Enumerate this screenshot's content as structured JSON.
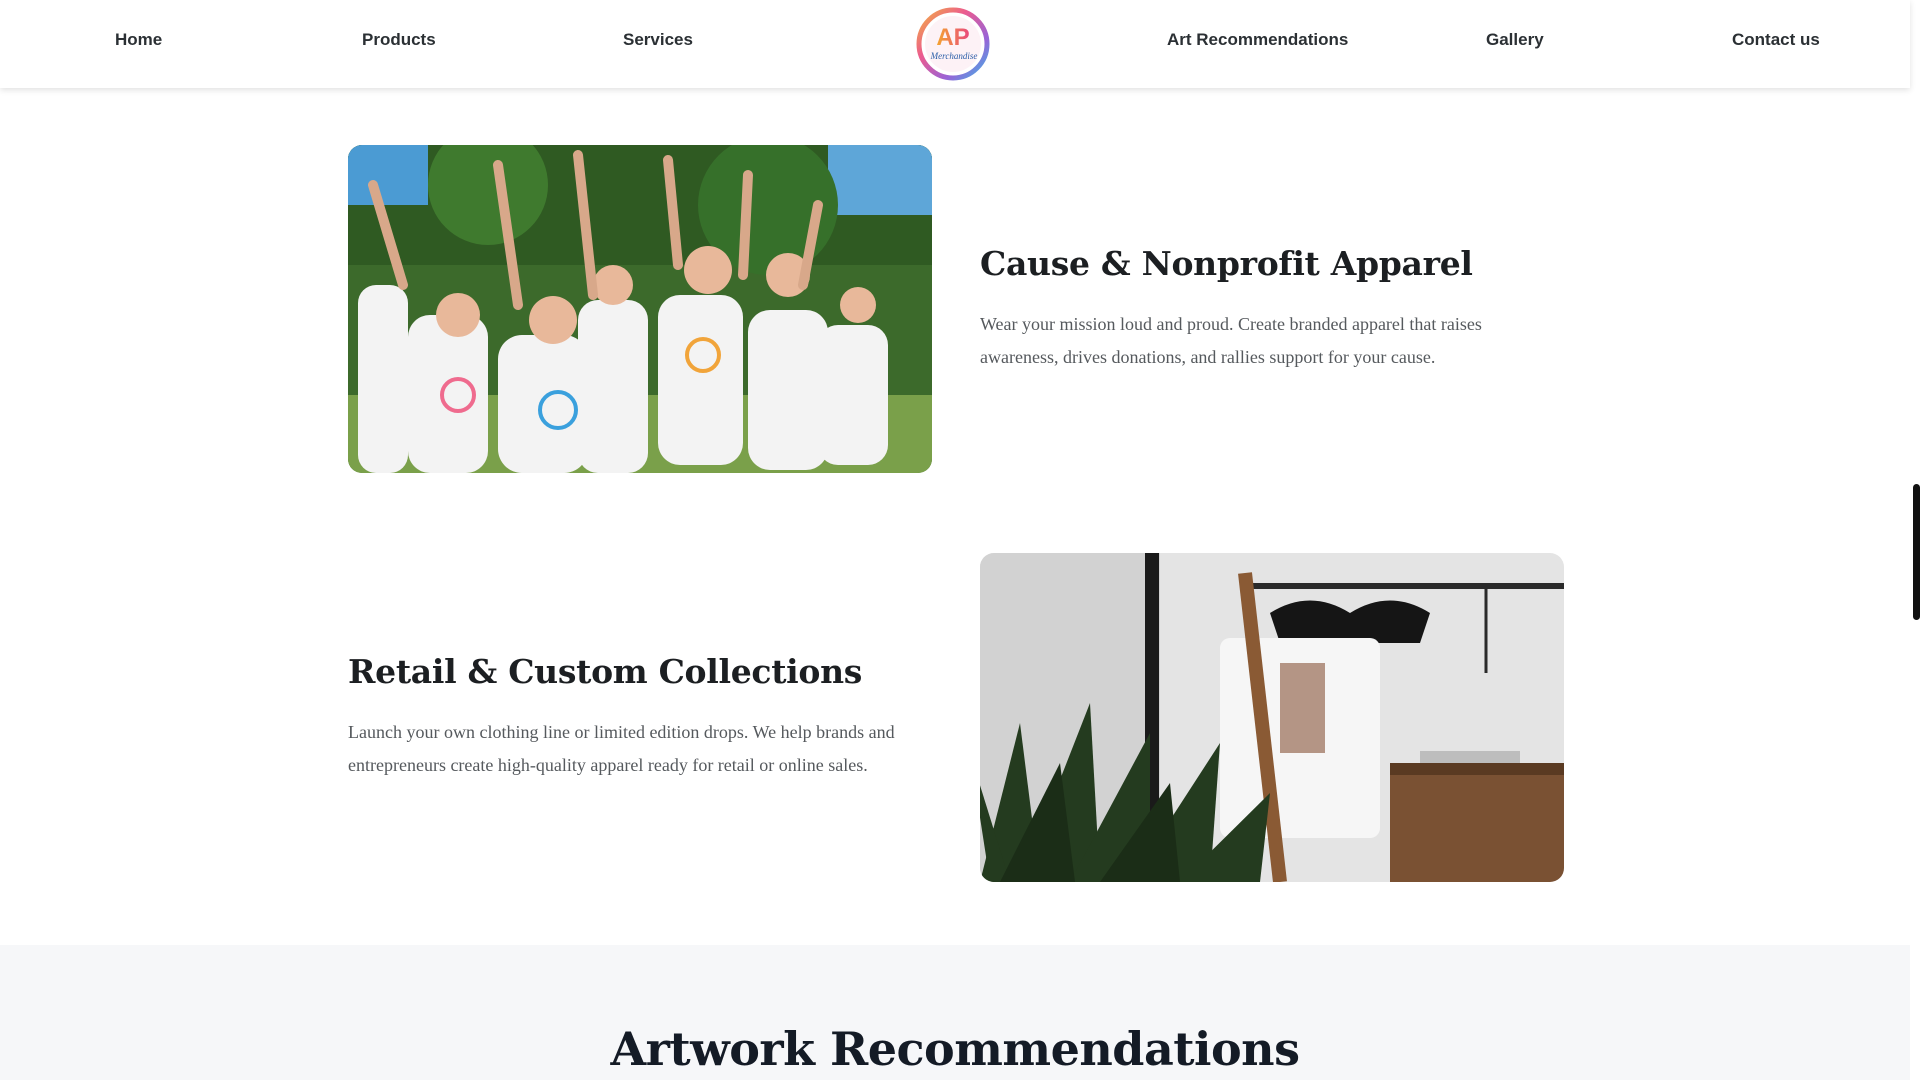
{
  "nav": {
    "items": [
      {
        "label": "Home"
      },
      {
        "label": "Products"
      },
      {
        "label": "Services"
      },
      {
        "label": "Art Recommendations"
      },
      {
        "label": "Gallery"
      },
      {
        "label": "Contact us"
      }
    ],
    "logo": {
      "mark": "AP",
      "script": "Merchandise"
    }
  },
  "features": [
    {
      "title": "Cause & Nonprofit Apparel",
      "description": "Wear your mission loud and proud. Create branded apparel that raises awareness, drives donations, and rallies support for your cause.",
      "image": "kids-in-event-tshirts-photo"
    },
    {
      "title": "Retail & Custom Collections",
      "description": "Launch your own clothing line or limited edition drops. We help brands and entrepreneurs create high-quality apparel ready for retail or online sales.",
      "image": "tshirts-on-rack-photo"
    }
  ],
  "artwork": {
    "heading": "Artwork Recommendations"
  },
  "colors": {
    "nav_text": "#2b3034",
    "heading": "#1c1f22",
    "body_text": "#55595d",
    "section_bg": "#f6f7f9"
  }
}
